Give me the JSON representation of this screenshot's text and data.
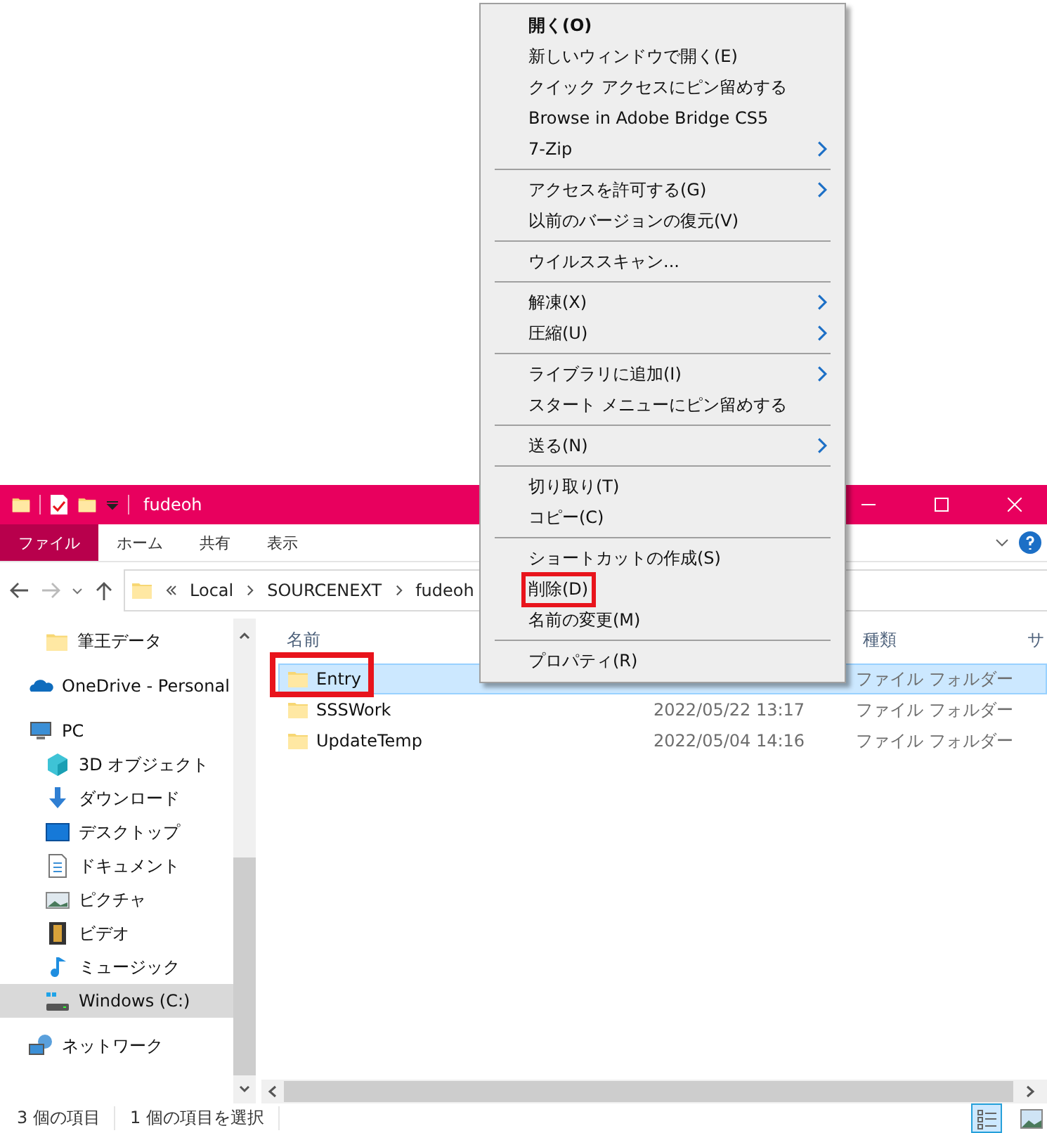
{
  "window": {
    "title": "fudeoh"
  },
  "ribbon": {
    "tabs": [
      {
        "label": "ファイル",
        "selected": true
      },
      {
        "label": "ホーム",
        "selected": false
      },
      {
        "label": "共有",
        "selected": false
      },
      {
        "label": "表示",
        "selected": false
      }
    ]
  },
  "address": {
    "path": [
      "Local",
      "SOURCENEXT",
      "fudeoh"
    ]
  },
  "nav": {
    "quick_access_children": [
      {
        "label": "筆王データ",
        "kind": "folder",
        "selected": false
      }
    ],
    "items": [
      {
        "label": "OneDrive - Personal",
        "kind": "cloud",
        "selected": false
      },
      {
        "label": "PC",
        "kind": "pc",
        "selected": false,
        "children": [
          {
            "label": "3D オブジェクト",
            "kind": "cube",
            "selected": false
          },
          {
            "label": "ダウンロード",
            "kind": "download",
            "selected": false
          },
          {
            "label": "デスクトップ",
            "kind": "desktop",
            "selected": false
          },
          {
            "label": "ドキュメント",
            "kind": "document",
            "selected": false
          },
          {
            "label": "ピクチャ",
            "kind": "pictures",
            "selected": false
          },
          {
            "label": "ビデオ",
            "kind": "video",
            "selected": false
          },
          {
            "label": "ミュージック",
            "kind": "music",
            "selected": false
          },
          {
            "label": "Windows (C:)",
            "kind": "drive",
            "selected": true
          }
        ]
      },
      {
        "label": "ネットワーク",
        "kind": "network",
        "selected": false
      }
    ]
  },
  "table": {
    "columns": [
      "名前",
      "種類",
      "サ"
    ],
    "rows": [
      {
        "name": "Entry",
        "type": "ファイル フォルダー",
        "selected": true,
        "highlighted": true
      },
      {
        "name": "SSSWork",
        "modified": "2022/05/22 13:17",
        "type": "ファイル フォルダー",
        "selected": false,
        "highlighted": false
      },
      {
        "name": "UpdateTemp",
        "modified": "2022/05/04 14:16",
        "type": "ファイル フォルダー",
        "selected": false,
        "highlighted": false
      }
    ]
  },
  "status_bar": [
    "3 個の項目",
    "1 個の項目を選択"
  ],
  "context_menu": [
    {
      "kind": "item",
      "label": "開く(O)",
      "bold": true,
      "submenu": false,
      "highlighted": false
    },
    {
      "kind": "item",
      "label": "新しいウィンドウで開く(E)",
      "bold": false,
      "submenu": false,
      "highlighted": false
    },
    {
      "kind": "item",
      "label": "クイック アクセスにピン留めする",
      "bold": false,
      "submenu": false,
      "highlighted": false
    },
    {
      "kind": "item",
      "label": "Browse in Adobe Bridge CS5",
      "bold": false,
      "submenu": false,
      "highlighted": false
    },
    {
      "kind": "item",
      "label": "7-Zip",
      "bold": false,
      "submenu": true,
      "highlighted": false
    },
    {
      "kind": "separator"
    },
    {
      "kind": "item",
      "label": "アクセスを許可する(G)",
      "bold": false,
      "submenu": true,
      "highlighted": false
    },
    {
      "kind": "item",
      "label": "以前のバージョンの復元(V)",
      "bold": false,
      "submenu": false,
      "highlighted": false
    },
    {
      "kind": "separator"
    },
    {
      "kind": "item",
      "label": "ウイルススキャン...",
      "bold": false,
      "submenu": false,
      "highlighted": false
    },
    {
      "kind": "separator"
    },
    {
      "kind": "item",
      "label": "解凍(X)",
      "bold": false,
      "submenu": true,
      "highlighted": false
    },
    {
      "kind": "item",
      "label": "圧縮(U)",
      "bold": false,
      "submenu": true,
      "highlighted": false
    },
    {
      "kind": "separator"
    },
    {
      "kind": "item",
      "label": "ライブラリに追加(I)",
      "bold": false,
      "submenu": true,
      "highlighted": false
    },
    {
      "kind": "item",
      "label": "スタート メニューにピン留めする",
      "bold": false,
      "submenu": false,
      "highlighted": false
    },
    {
      "kind": "separator"
    },
    {
      "kind": "item",
      "label": "送る(N)",
      "bold": false,
      "submenu": true,
      "highlighted": false
    },
    {
      "kind": "separator"
    },
    {
      "kind": "item",
      "label": "切り取り(T)",
      "bold": false,
      "submenu": false,
      "highlighted": false
    },
    {
      "kind": "item",
      "label": "コピー(C)",
      "bold": false,
      "submenu": false,
      "highlighted": false
    },
    {
      "kind": "separator"
    },
    {
      "kind": "item",
      "label": "ショートカットの作成(S)",
      "bold": false,
      "submenu": false,
      "highlighted": false
    },
    {
      "kind": "item",
      "label": "削除(D)",
      "bold": false,
      "submenu": false,
      "highlighted": true
    },
    {
      "kind": "item",
      "label": "名前の変更(M)",
      "bold": false,
      "submenu": false,
      "highlighted": false
    },
    {
      "kind": "separator"
    },
    {
      "kind": "item",
      "label": "プロパティ(R)",
      "bold": false,
      "submenu": false,
      "highlighted": false
    }
  ]
}
